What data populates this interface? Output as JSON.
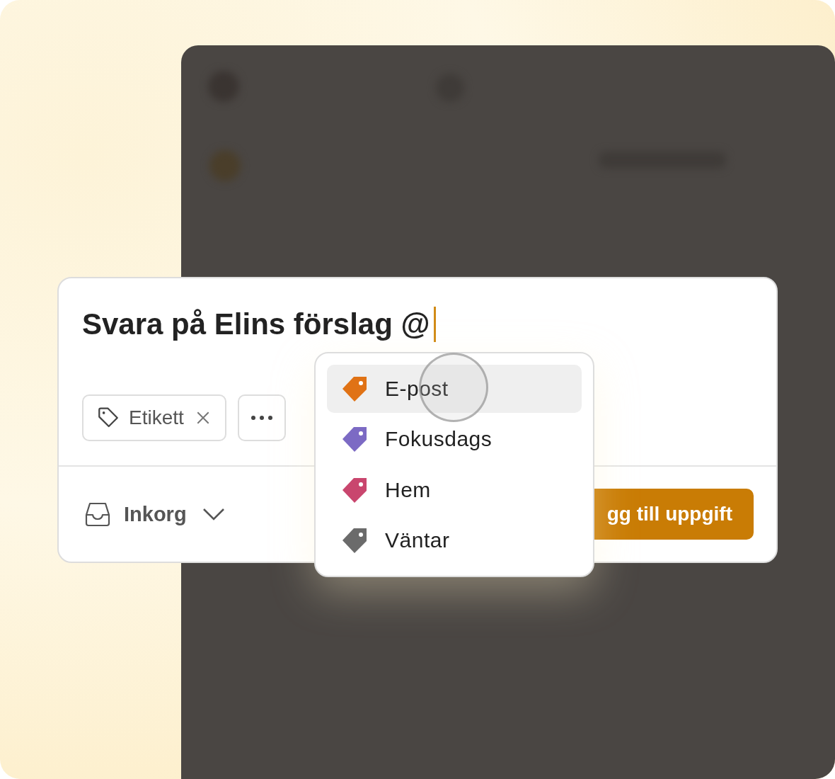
{
  "task_dialog": {
    "title": "Svara på Elins förslag @",
    "chips": [
      {
        "kind": "label",
        "text": "Etikett"
      },
      {
        "kind": "more"
      }
    ],
    "project": "Inkorg",
    "submit_button": "gg till uppgift"
  },
  "label_menu": {
    "items": [
      {
        "name": "E-post",
        "color": "#e07215",
        "selected": true
      },
      {
        "name": "Fokusdags",
        "color": "#7c6ac4",
        "selected": false
      },
      {
        "name": "Hem",
        "color": "#c9466e",
        "selected": false
      },
      {
        "name": "Väntar",
        "color": "#6b6b6b",
        "selected": false
      }
    ]
  }
}
